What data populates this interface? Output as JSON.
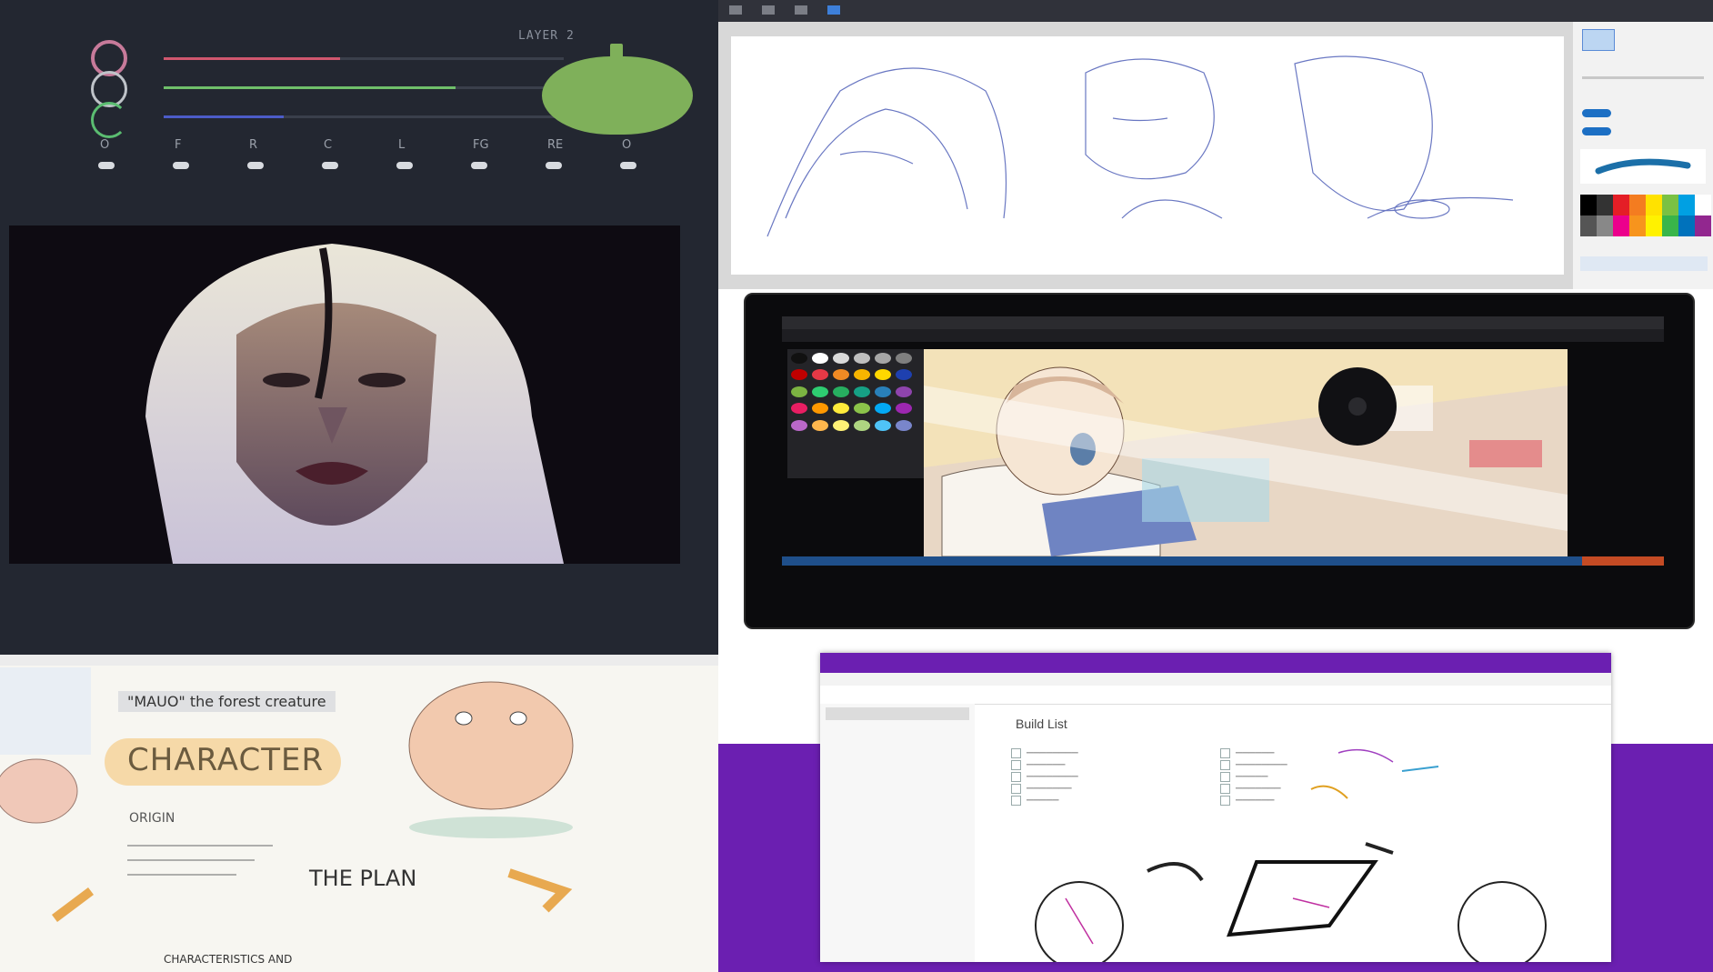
{
  "paint_app": {
    "layer_label": "LAYER 2",
    "color_swatch": "#7fb05a",
    "sliders": [
      {
        "name": "red",
        "color": "#d0576f",
        "level": 0.44
      },
      {
        "name": "green",
        "color": "#6fbf6a",
        "level": 0.73
      },
      {
        "name": "blue",
        "color": "#4c5cc8",
        "level": 0.3
      }
    ],
    "tool_letters": [
      "O",
      "F",
      "R",
      "C",
      "L",
      "FG",
      "RE",
      "O"
    ],
    "icons": [
      "hue-ring-icon",
      "saturation-ring-icon",
      "value-ring-icon"
    ]
  },
  "sketch_app": {
    "toolbar_icons": [
      "menu-icon",
      "brush-icon",
      "move-icon",
      "pen-icon"
    ],
    "palette": [
      "#000000",
      "#333333",
      "#e41e26",
      "#f47c20",
      "#ffe200",
      "#7ac143",
      "#00a0e3",
      "#ffffff",
      "#555555",
      "#888888",
      "#ec008c",
      "#f7941d",
      "#fff200",
      "#39b54a",
      "#0072bc",
      "#92278f"
    ]
  },
  "tablet_app": {
    "color_grid": [
      "#111111",
      "#ffffff",
      "#d9d9d9",
      "#bfbfbf",
      "#a6a6a6",
      "#7f7f7f",
      "#c00000",
      "#e63946",
      "#f08a24",
      "#f7b500",
      "#ffd700",
      "#1e40af",
      "#7cb342",
      "#2ecc71",
      "#27ae60",
      "#16a085",
      "#2980b9",
      "#8e44ad",
      "#e91e63",
      "#ff9800",
      "#ffeb3b",
      "#8bc34a",
      "#03a9f4",
      "#9c27b0",
      "#ba68c8",
      "#ffb74d",
      "#fff176",
      "#aed581",
      "#4fc3f7",
      "#7986cb"
    ]
  },
  "notes_app": {
    "texts": [
      "\"MAUO\" the forest creature",
      "CHARACTER",
      "ORIGIN",
      "THE PLAN",
      "CHARACTERISTICS AND"
    ]
  },
  "onenote_app": {
    "page_title": "Build List",
    "accent": "#6b1fb1"
  }
}
